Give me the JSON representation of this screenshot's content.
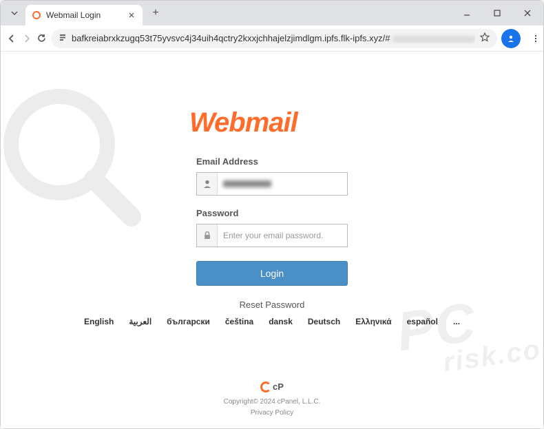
{
  "tab": {
    "title": "Webmail Login"
  },
  "url": "bafkreiabrxkzugq53t75yvsvc4j34uih4qctry2kxxjchhajelzjimdlgm.ipfs.flk-ipfs.xyz/#",
  "logo_text": "Webmail",
  "form": {
    "email_label": "Email Address",
    "password_label": "Password",
    "password_placeholder": "Enter your email password.",
    "login_button": "Login",
    "reset_password": "Reset Password"
  },
  "languages": [
    "English",
    "العربية",
    "български",
    "čeština",
    "dansk",
    "Deutsch",
    "Ελληνικά",
    "español",
    "..."
  ],
  "footer": {
    "brand": "cP",
    "copyright": "Copyright© 2024 cPanel, L.L.C.",
    "privacy": "Privacy Policy"
  },
  "watermark": {
    "line1": "PC",
    "line2": "risk.com"
  }
}
